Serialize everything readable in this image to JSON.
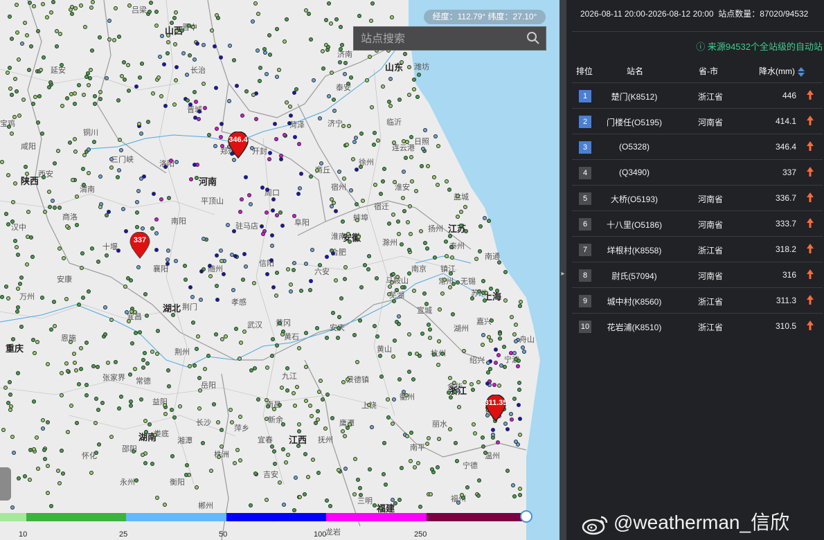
{
  "map": {
    "coord_readout": "经度：112.79°  纬度：27.10°",
    "search": {
      "placeholder": "站点搜索"
    },
    "provinces": [
      "山西",
      "山东",
      "陕西",
      "河南",
      "江苏",
      "安徽",
      "湖北",
      "上海",
      "浙江",
      "湖南",
      "江西",
      "福建",
      "重庆"
    ],
    "cities": [
      "吕梁",
      "晋中",
      "延安",
      "长治",
      "晋城",
      "济南",
      "泰安",
      "潍坊",
      "铜川",
      "咸阳",
      "西安",
      "洛阳",
      "三门峡",
      "郑州",
      "开封",
      "商丘",
      "菏泽",
      "济宁",
      "临沂",
      "日照",
      "徐州",
      "连云港",
      "平顶山",
      "周口",
      "宿州",
      "淮安",
      "宿迁",
      "盐城",
      "南阳",
      "驻马店",
      "阜阳",
      "蚌埠",
      "淮南",
      "扬州",
      "泰州",
      "南通",
      "十堰",
      "信阳",
      "合肥",
      "六安",
      "滁州",
      "南京",
      "镇江",
      "常州",
      "无锡",
      "苏州",
      "随州",
      "襄阳",
      "孝感",
      "黄冈",
      "安庆",
      "芜湖",
      "马鞍山",
      "宣城",
      "湖州",
      "嘉兴",
      "杭州",
      "绍兴",
      "宁波",
      "舟山",
      "荆门",
      "宜昌",
      "荆州",
      "武汉",
      "黄石",
      "九江",
      "景德镇",
      "黄山",
      "衢州",
      "金华",
      "台州",
      "温州",
      "丽水",
      "岳阳",
      "常德",
      "张家界",
      "益阳",
      "长沙",
      "南昌",
      "上饶",
      "鹰潭",
      "抚州",
      "宜春",
      "新余",
      "萍乡",
      "株洲",
      "湘潭",
      "娄底",
      "邵阳",
      "衡阳",
      "吉安",
      "赣州",
      "怀化",
      "永州",
      "郴州",
      "南平",
      "宁德",
      "三明",
      "福州",
      "龙岩",
      "恩施",
      "汉中",
      "安康",
      "万州",
      "商洛",
      "宝鸡",
      "渭南"
    ],
    "pin_labels": [
      "346.4",
      "337",
      "311.35"
    ],
    "legend": {
      "ticks": [
        "10",
        "25",
        "50",
        "100",
        "250"
      ],
      "colors": [
        "#a6e89a",
        "#3db23d",
        "#63b8ff",
        "#0000ff",
        "#ff00ff",
        "#7a0044"
      ]
    },
    "station_colors": {
      "low": "#93d06a",
      "light": "#43a348",
      "moderate": "#6aa6de",
      "heavy": "#1414c8",
      "very_heavy": "#e010e0",
      "extreme": "#7a0044"
    }
  },
  "panel": {
    "time_range": "2026-08-11 20:00-2026-08-12 20:00",
    "station_count_label": "站点数量：87020/94532",
    "source_note": "来源94532个全站级的自动站",
    "columns": {
      "rank": "排位",
      "station": "站名",
      "province": "省-市",
      "rain": "降水(mm)"
    },
    "rows": [
      {
        "rank": "1",
        "station": "楚门(K8512)",
        "province": "浙江省",
        "value": "446"
      },
      {
        "rank": "2",
        "station": "门楼任(O5195)",
        "province": "河南省",
        "value": "414.1"
      },
      {
        "rank": "3",
        "station": "(O5328)",
        "province": "",
        "value": "346.4"
      },
      {
        "rank": "4",
        "station": "(Q3490)",
        "province": "",
        "value": "337"
      },
      {
        "rank": "5",
        "station": "大桥(O5193)",
        "province": "河南省",
        "value": "336.7"
      },
      {
        "rank": "6",
        "station": "十八里(O5186)",
        "province": "河南省",
        "value": "333.7"
      },
      {
        "rank": "7",
        "station": "垟根村(K8558)",
        "province": "浙江省",
        "value": "318.2"
      },
      {
        "rank": "8",
        "station": "尉氏(57094)",
        "province": "河南省",
        "value": "316"
      },
      {
        "rank": "9",
        "station": "城中村(K8560)",
        "province": "浙江省",
        "value": "311.3"
      },
      {
        "rank": "10",
        "station": "花岩浦(K8510)",
        "province": "浙江省",
        "value": "310.5"
      }
    ],
    "rank_colors": {
      "top": "#4a7fd4",
      "rest": "#4a4c50"
    },
    "trend_color": "#ff6a3a"
  },
  "watermark": "@weatherman_信欣"
}
